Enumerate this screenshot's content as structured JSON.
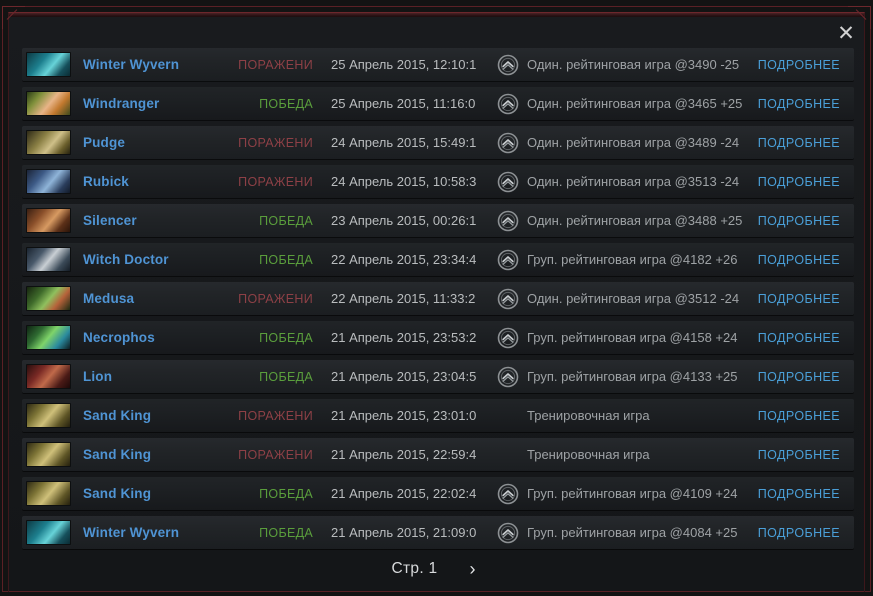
{
  "window": {
    "close_label": "✕"
  },
  "matches": [
    {
      "hero": "Winter Wyvern",
      "hero_portrait": "winter-wyvern",
      "result": "ПОРАЖЕНИ",
      "result_type": "loss",
      "date": "25 Апрель 2015, 12:10:1",
      "mode": "Один. рейтинговая игра @3490 -25",
      "has_icon": true,
      "details": "ПОДРОБНЕЕ"
    },
    {
      "hero": "Windranger",
      "hero_portrait": "windranger",
      "result": "ПОБЕДА",
      "result_type": "win",
      "date": "25 Апрель 2015, 11:16:0",
      "mode": "Один. рейтинговая игра @3465 +25",
      "has_icon": true,
      "details": "ПОДРОБНЕЕ"
    },
    {
      "hero": "Pudge",
      "hero_portrait": "pudge",
      "result": "ПОРАЖЕНИ",
      "result_type": "loss",
      "date": "24 Апрель 2015, 15:49:1",
      "mode": "Один. рейтинговая игра @3489 -24",
      "has_icon": true,
      "details": "ПОДРОБНЕЕ"
    },
    {
      "hero": "Rubick",
      "hero_portrait": "rubick",
      "result": "ПОРАЖЕНИ",
      "result_type": "loss",
      "date": "24 Апрель 2015, 10:58:3",
      "mode": "Один. рейтинговая игра @3513 -24",
      "has_icon": true,
      "details": "ПОДРОБНЕЕ"
    },
    {
      "hero": "Silencer",
      "hero_portrait": "silencer",
      "result": "ПОБЕДА",
      "result_type": "win",
      "date": "23 Апрель 2015, 00:26:1",
      "mode": "Один. рейтинговая игра @3488 +25",
      "has_icon": true,
      "details": "ПОДРОБНЕЕ"
    },
    {
      "hero": "Witch Doctor",
      "hero_portrait": "witch-doctor",
      "result": "ПОБЕДА",
      "result_type": "win",
      "date": "22 Апрель 2015, 23:34:4",
      "mode": "Груп. рейтинговая игра @4182 +26",
      "has_icon": true,
      "details": "ПОДРОБНЕЕ"
    },
    {
      "hero": "Medusa",
      "hero_portrait": "medusa",
      "result": "ПОРАЖЕНИ",
      "result_type": "loss",
      "date": "22 Апрель 2015, 11:33:2",
      "mode": "Один. рейтинговая игра @3512 -24",
      "has_icon": true,
      "details": "ПОДРОБНЕЕ"
    },
    {
      "hero": "Necrophos",
      "hero_portrait": "necrophos",
      "result": "ПОБЕДА",
      "result_type": "win",
      "date": "21 Апрель 2015, 23:53:2",
      "mode": "Груп. рейтинговая игра @4158 +24",
      "has_icon": true,
      "details": "ПОДРОБНЕЕ"
    },
    {
      "hero": "Lion",
      "hero_portrait": "lion",
      "result": "ПОБЕДА",
      "result_type": "win",
      "date": "21 Апрель 2015, 23:04:5",
      "mode": "Груп. рейтинговая игра @4133 +25",
      "has_icon": true,
      "details": "ПОДРОБНЕЕ"
    },
    {
      "hero": "Sand King",
      "hero_portrait": "sand-king",
      "result": "ПОРАЖЕНИ",
      "result_type": "loss",
      "date": "21 Апрель 2015, 23:01:0",
      "mode": "Тренировочная игра",
      "has_icon": false,
      "details": "ПОДРОБНЕЕ"
    },
    {
      "hero": "Sand King",
      "hero_portrait": "sand-king",
      "result": "ПОРАЖЕНИ",
      "result_type": "loss",
      "date": "21 Апрель 2015, 22:59:4",
      "mode": "Тренировочная игра",
      "has_icon": false,
      "details": "ПОДРОБНЕЕ"
    },
    {
      "hero": "Sand King",
      "hero_portrait": "sand-king",
      "result": "ПОБЕДА",
      "result_type": "win",
      "date": "21 Апрель 2015, 22:02:4",
      "mode": "Груп. рейтинговая игра @4109 +24",
      "has_icon": true,
      "details": "ПОДРОБНЕЕ"
    },
    {
      "hero": "Winter Wyvern",
      "hero_portrait": "winter-wyvern",
      "result": "ПОБЕДА",
      "result_type": "win",
      "date": "21 Апрель 2015, 21:09:0",
      "mode": "Груп. рейтинговая игра @4084 +25",
      "has_icon": true,
      "details": "ПОДРОБНЕЕ"
    }
  ],
  "pagination": {
    "page_label": "Стр. 1",
    "next_label": "›"
  },
  "colors": {
    "hero_name": "#4f94d4",
    "win": "#5a9e3c",
    "loss": "#8d4046",
    "details_link": "#4a9fd8",
    "frame": "#6d272c",
    "panel_bg": "#17191b"
  }
}
